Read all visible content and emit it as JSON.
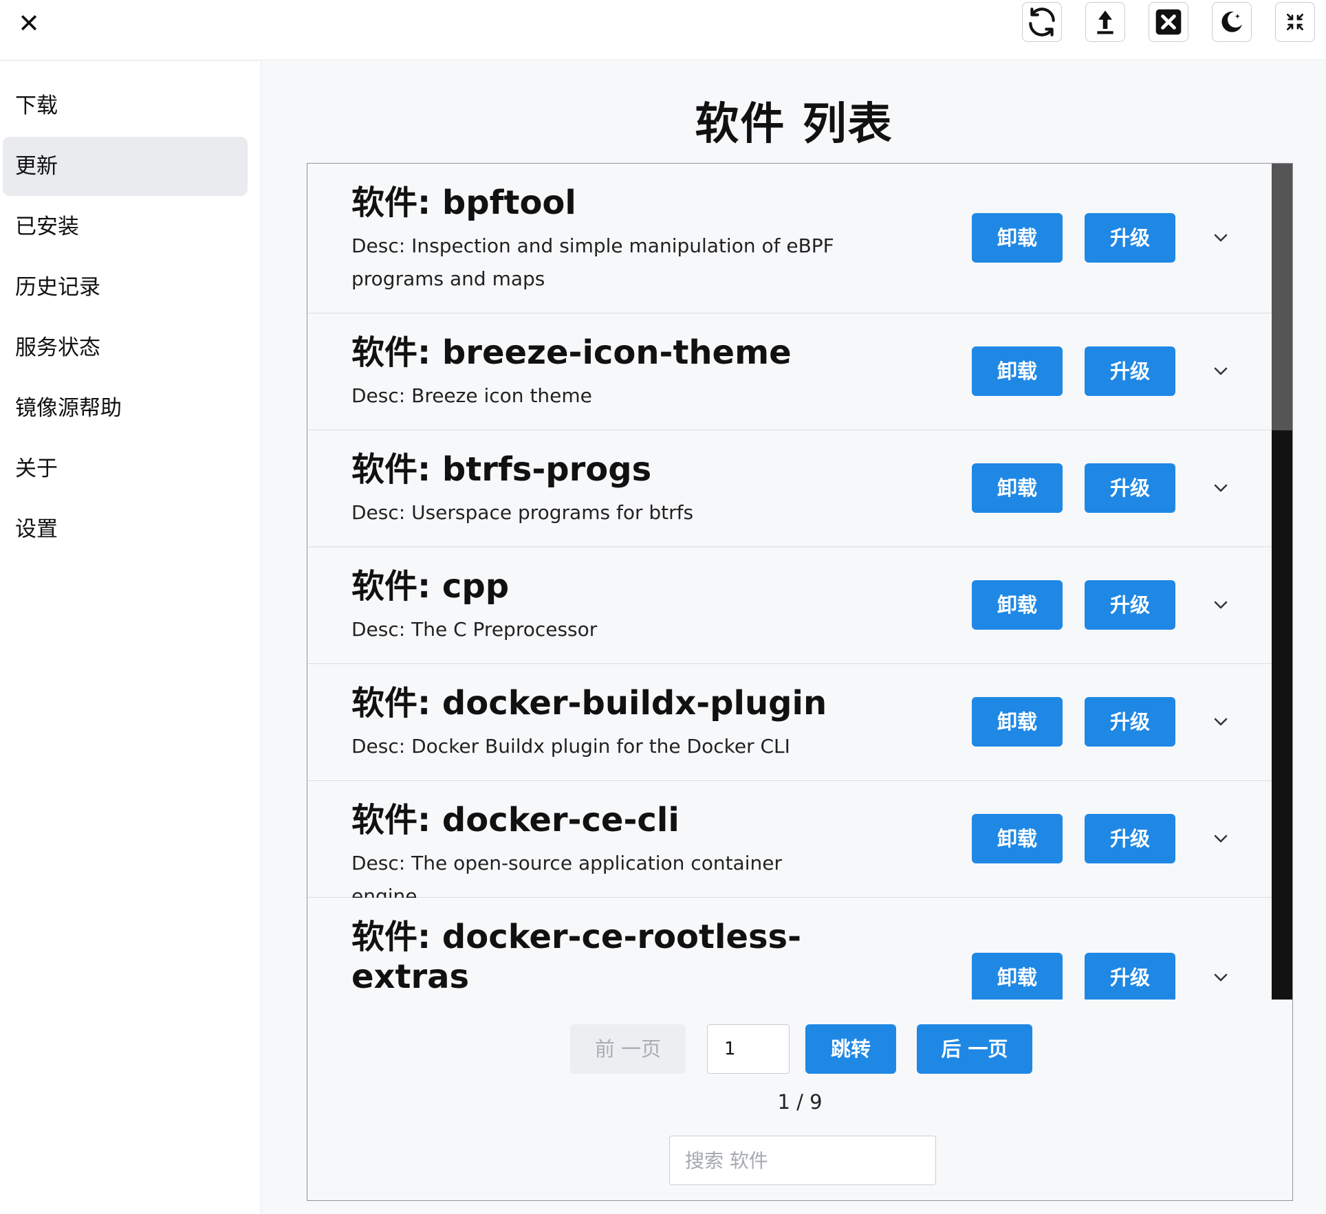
{
  "window": {
    "close_symbol": "✕",
    "toolbar_icons": [
      "refresh-icon",
      "upload-icon",
      "close-square-icon",
      "moon-icon",
      "collapse-icon"
    ]
  },
  "sidebar": {
    "items": [
      {
        "label": "下载",
        "active": false
      },
      {
        "label": "更新",
        "active": true
      },
      {
        "label": "已安装",
        "active": false
      },
      {
        "label": "历史记录",
        "active": false
      },
      {
        "label": "服务状态",
        "active": false
      },
      {
        "label": "镜像源帮助",
        "active": false
      },
      {
        "label": "关于",
        "active": false
      },
      {
        "label": "设置",
        "active": false
      }
    ]
  },
  "main": {
    "title": "软件 列表",
    "packages": [
      {
        "name": "软件: bpftool",
        "desc": "Desc: Inspection and simple manipulation of eBPF programs and maps",
        "uninstall": "卸载",
        "upgrade": "升级"
      },
      {
        "name": "软件: breeze-icon-theme",
        "desc": "Desc: Breeze icon theme",
        "uninstall": "卸载",
        "upgrade": "升级"
      },
      {
        "name": "软件: btrfs-progs",
        "desc": "Desc: Userspace programs for btrfs",
        "uninstall": "卸载",
        "upgrade": "升级"
      },
      {
        "name": "软件: cpp",
        "desc": "Desc: The C Preprocessor",
        "uninstall": "卸载",
        "upgrade": "升级"
      },
      {
        "name": "软件: docker-buildx-plugin",
        "desc": "Desc: Docker Buildx plugin for the Docker CLI",
        "uninstall": "卸载",
        "upgrade": "升级"
      },
      {
        "name": "软件: docker-ce-cli",
        "desc": "Desc: The open-source application container engine",
        "uninstall": "卸载",
        "upgrade": "升级"
      },
      {
        "name": "软件: docker-ce-rootless-extras",
        "desc": "",
        "uninstall": "卸载",
        "upgrade": "升级"
      }
    ],
    "pagination": {
      "prev_label": "前 一页",
      "page_value": "1",
      "go_label": "跳转",
      "next_label": "后 一页",
      "indicator": "1 / 9"
    },
    "search": {
      "placeholder": "搜索 软件",
      "value": ""
    }
  },
  "colors": {
    "accent": "#1f88e5",
    "active_nav_bg": "#e9ebee",
    "main_bg": "#f7f8fa",
    "scrollbar_track": "#121212",
    "scrollbar_thumb": "#555555"
  }
}
